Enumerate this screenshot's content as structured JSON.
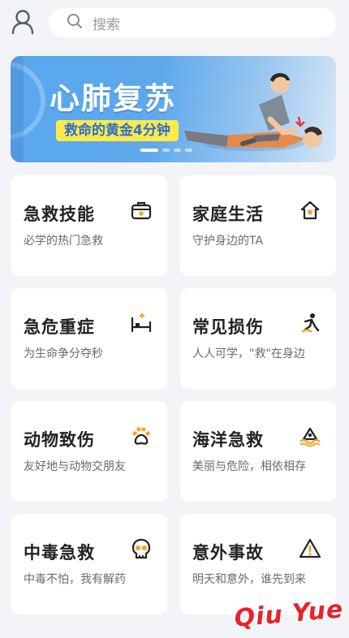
{
  "search": {
    "placeholder": "搜索"
  },
  "banner": {
    "title": "心肺复苏",
    "subtitle": "救命的黄金4分钟",
    "page_count": 4,
    "active_page": 1
  },
  "categories": [
    {
      "title": "急救技能",
      "subtitle": "必学的热门急救",
      "icon": "first-aid-kit-icon"
    },
    {
      "title": "家庭生活",
      "subtitle": "守护身边的TA",
      "icon": "home-heart-icon"
    },
    {
      "title": "急危重症",
      "subtitle": "为生命争分夺秒",
      "icon": "hospital-bed-icon"
    },
    {
      "title": "常见损伤",
      "subtitle": "人人可学，\"救\"在身边",
      "icon": "falling-person-icon"
    },
    {
      "title": "动物致伤",
      "subtitle": "友好地与动物交朋友",
      "icon": "paw-icon"
    },
    {
      "title": "海洋急救",
      "subtitle": "美丽与危险，相依相存",
      "icon": "ocean-wave-icon"
    },
    {
      "title": "中毒急救",
      "subtitle": "中毒不怕，我有解药",
      "icon": "skull-icon"
    },
    {
      "title": "意外事故",
      "subtitle": "明天和意外，谁先到来",
      "icon": "warning-icon"
    }
  ],
  "watermark": {
    "text": "Qiu Yue"
  },
  "colors": {
    "accent": "#f5a623",
    "dark": "#222222",
    "background": "#f3f4f8"
  }
}
